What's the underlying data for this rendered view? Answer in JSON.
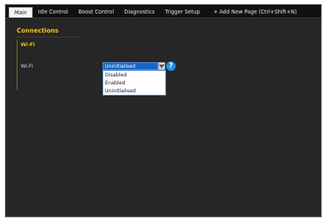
{
  "tabs": [
    {
      "label": "Main",
      "active": true
    },
    {
      "label": "Idle Control",
      "active": false
    },
    {
      "label": "Boost Control",
      "active": false
    },
    {
      "label": "Diagnostics",
      "active": false
    },
    {
      "label": "Trigger Setup",
      "active": false
    },
    {
      "label": "+ Add New Page (Ctrl+Shift+N)",
      "active": false
    }
  ],
  "section": {
    "title": "Connections",
    "group_title": "Wi-Fi"
  },
  "wifi": {
    "label": "Wi-Fi",
    "value": "Uninitialised",
    "help_icon": "question-circle-icon",
    "options": [
      "Disabled",
      "Enabled",
      "Uninitialised"
    ]
  },
  "colors": {
    "accent": "#f0c419",
    "selection": "#1766c5",
    "help": "#1d8fe8",
    "background": "#262626"
  }
}
